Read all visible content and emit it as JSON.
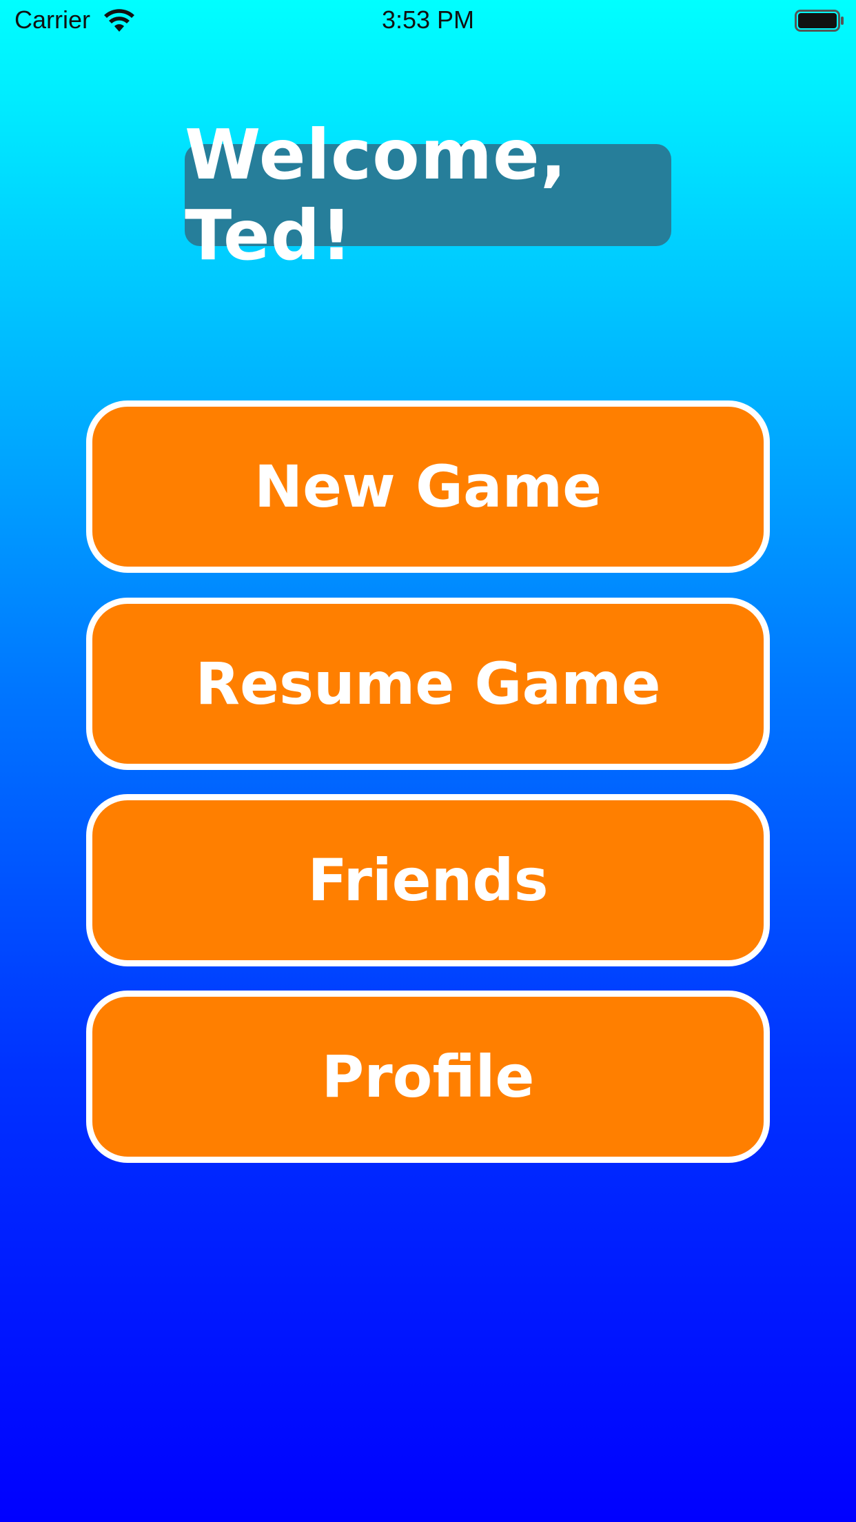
{
  "status_bar": {
    "carrier": "Carrier",
    "time": "3:53 PM",
    "wifi_icon": "wifi-icon",
    "battery_icon": "battery-icon"
  },
  "title": "Welcome, Ted!",
  "menu": {
    "new_game": "New Game",
    "resume_game": "Resume Game",
    "friends": "Friends",
    "profile": "Profile"
  },
  "colors": {
    "button_fill": "#ff7f00",
    "button_border": "#ffffff",
    "title_bg": "#267e9a",
    "gradient_top": "#00ffff",
    "gradient_bottom": "#0000ff"
  }
}
